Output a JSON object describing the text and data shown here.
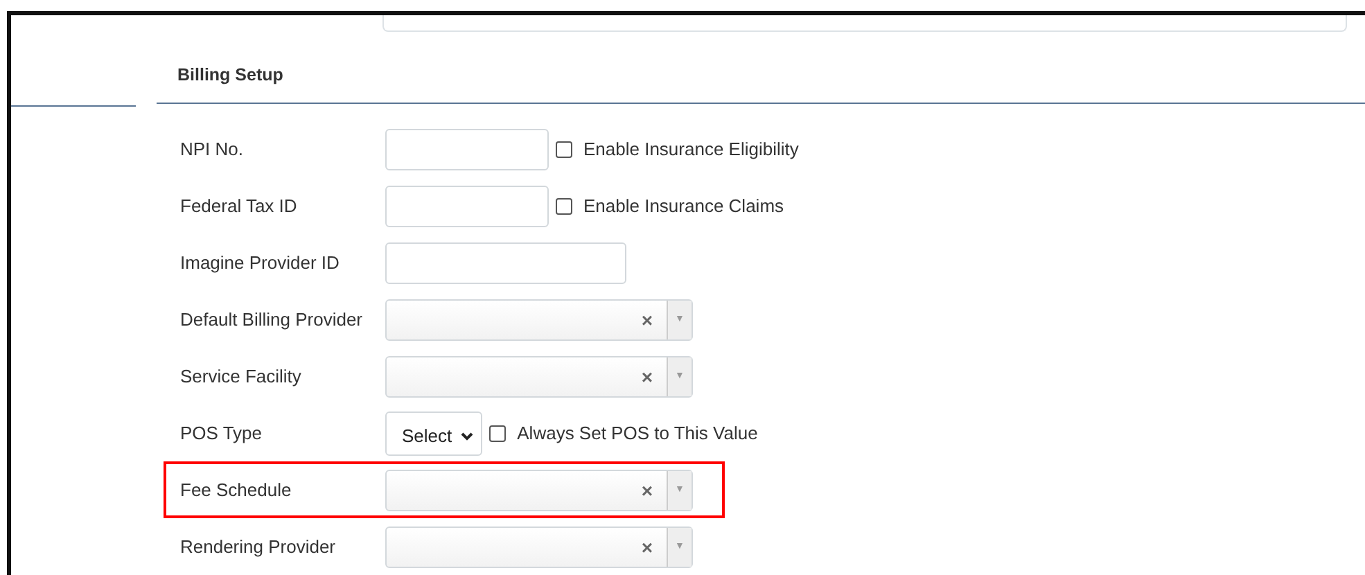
{
  "section": {
    "title": "Billing Setup"
  },
  "rows": [
    {
      "kind": "text",
      "label": "NPI No.",
      "checkbox": {
        "label": "Enable Insurance Eligibility",
        "checked": false
      },
      "highlighted": false
    },
    {
      "kind": "text",
      "label": "Federal Tax ID",
      "checkbox": {
        "label": "Enable Insurance Claims",
        "checked": false
      },
      "highlighted": false
    },
    {
      "kind": "text",
      "label": "Imagine Provider ID",
      "highlighted": false
    },
    {
      "kind": "combo",
      "label": "Default Billing Provider",
      "clear": "×",
      "toggle": "▼",
      "highlighted": false
    },
    {
      "kind": "combo",
      "label": "Service Facility",
      "clear": "×",
      "toggle": "▼",
      "highlighted": false
    },
    {
      "kind": "select",
      "label": "POS Type",
      "value": "Select",
      "checkbox": {
        "label": "Always Set POS to This Value",
        "checked": false
      },
      "highlighted": false
    },
    {
      "kind": "combo",
      "label": "Fee Schedule",
      "clear": "×",
      "toggle": "▼",
      "highlighted": true
    },
    {
      "kind": "combo",
      "label": "Rendering Provider",
      "clear": "×",
      "toggle": "▼",
      "highlighted": false
    }
  ]
}
